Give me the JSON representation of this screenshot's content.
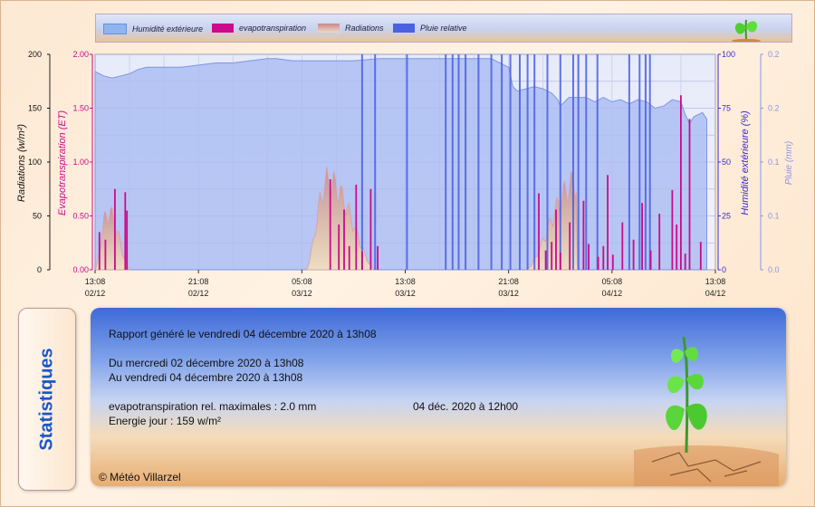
{
  "legend": {
    "items": [
      {
        "label": "Humidité extérieure",
        "color": "#8fb4f0"
      },
      {
        "label": "evapotranspiration",
        "color": "#cc0a8a"
      },
      {
        "label": "Radiations",
        "color": "#d9a0a0"
      },
      {
        "label": "Pluie relative",
        "color": "#4a62e0"
      }
    ]
  },
  "chart_data": {
    "type": "bar",
    "axes": {
      "radiation": {
        "label": "Radiations (w/m²)",
        "range": [
          0,
          200
        ],
        "ticks": [
          "0",
          "50",
          "100",
          "150",
          "200"
        ],
        "color": "#111111"
      },
      "et": {
        "label": "Evapotranspiration (ET)",
        "range": [
          0,
          2.0
        ],
        "ticks": [
          "0.00",
          "0.50",
          "1.00",
          "1.50",
          "2.00"
        ],
        "color": "#cc0a8a"
      },
      "humidity": {
        "label": "Humidité extérieure (%)",
        "range": [
          0,
          100
        ],
        "ticks": [
          "0",
          "25",
          "50",
          "75",
          "100"
        ],
        "color": "#3a2ccc"
      },
      "rain": {
        "label": "Pluie (mm)",
        "range": [
          0,
          0.2
        ],
        "ticks": [
          "0.0",
          "0.1",
          "0.1",
          "0.2",
          "0.2"
        ],
        "color": "#8a94e8"
      }
    },
    "x_ticks": [
      {
        "time": "13:08",
        "date": "02/12"
      },
      {
        "time": "21:08",
        "date": "02/12"
      },
      {
        "time": "05:08",
        "date": "03/12"
      },
      {
        "time": "13:08",
        "date": "03/12"
      },
      {
        "time": "21:08",
        "date": "03/12"
      },
      {
        "time": "05:08",
        "date": "04/12"
      },
      {
        "time": "13:08",
        "date": "04/12"
      }
    ],
    "humidity": [
      [
        0,
        92
      ],
      [
        1,
        90
      ],
      [
        2,
        89
      ],
      [
        3,
        90
      ],
      [
        4,
        91
      ],
      [
        5,
        93
      ],
      [
        6,
        94
      ],
      [
        8,
        94
      ],
      [
        10,
        94
      ],
      [
        12,
        95
      ],
      [
        14,
        96
      ],
      [
        16,
        96
      ],
      [
        18,
        97
      ],
      [
        20,
        98
      ],
      [
        21,
        98
      ],
      [
        23,
        97
      ],
      [
        26,
        97
      ],
      [
        28,
        97
      ],
      [
        30,
        97
      ],
      [
        33,
        98
      ],
      [
        36,
        98
      ],
      [
        39,
        98
      ],
      [
        42,
        98
      ],
      [
        44,
        98
      ],
      [
        46,
        98
      ],
      [
        48,
        94
      ],
      [
        48.5,
        85
      ],
      [
        49,
        83
      ],
      [
        50,
        84
      ],
      [
        51,
        85
      ],
      [
        52,
        84
      ],
      [
        53,
        82
      ],
      [
        53.7,
        79
      ],
      [
        54,
        76
      ],
      [
        55,
        80
      ],
      [
        56,
        80
      ],
      [
        57,
        80
      ],
      [
        58,
        78
      ],
      [
        59,
        80
      ],
      [
        60,
        78
      ],
      [
        61,
        79
      ],
      [
        62,
        77
      ],
      [
        63,
        79
      ],
      [
        64,
        78
      ],
      [
        65,
        75
      ],
      [
        66,
        76
      ],
      [
        67,
        79
      ],
      [
        68,
        78
      ],
      [
        68.5,
        72
      ],
      [
        69,
        68
      ],
      [
        69.5,
        71
      ],
      [
        70,
        72
      ],
      [
        70.5,
        73
      ],
      [
        71,
        70
      ]
    ],
    "radiation_profiles": [
      {
        "start": 0,
        "end": 4,
        "peak_hour": 1.5,
        "peak": 62
      },
      {
        "start": 24.5,
        "end": 32.5,
        "peak_hour": 27,
        "peak": 96
      },
      {
        "start": 50,
        "end": 56,
        "peak_hour": 56,
        "peak": 95
      }
    ],
    "et": [
      [
        0.5,
        0.35
      ],
      [
        1.2,
        0.28
      ],
      [
        2.3,
        0.75
      ],
      [
        3.5,
        0.72
      ],
      [
        3.7,
        0.55
      ],
      [
        27.3,
        0.84
      ],
      [
        28.3,
        0.42
      ],
      [
        28.9,
        0.56
      ],
      [
        29.5,
        0.22
      ],
      [
        30.3,
        0.79
      ],
      [
        31.0,
        0.17
      ],
      [
        32.0,
        0.75
      ],
      [
        32.8,
        0.22
      ],
      [
        51.5,
        0.71
      ],
      [
        52.3,
        0.18
      ],
      [
        53.0,
        0.26
      ],
      [
        53.5,
        0.56
      ],
      [
        54.0,
        0.16
      ],
      [
        55.1,
        0.44
      ],
      [
        56.7,
        0.64
      ],
      [
        57.3,
        0.24
      ],
      [
        58.4,
        0.12
      ],
      [
        59.0,
        0.22
      ],
      [
        59.5,
        0.88
      ],
      [
        60.1,
        0.14
      ],
      [
        61.2,
        0.44
      ],
      [
        62.5,
        0.28
      ],
      [
        63.5,
        0.62
      ],
      [
        64.5,
        0.18
      ],
      [
        65.5,
        0.52
      ],
      [
        67.0,
        0.74
      ],
      [
        67.5,
        0.42
      ],
      [
        68.0,
        1.62
      ],
      [
        68.5,
        0.15
      ],
      [
        69.0,
        1.4
      ],
      [
        70.3,
        0.26
      ]
    ],
    "rain": [
      [
        31.0,
        0.2
      ],
      [
        32.5,
        0.2
      ],
      [
        36.2,
        0.2
      ],
      [
        40.7,
        0.2
      ],
      [
        41.5,
        0.2
      ],
      [
        42.2,
        0.2
      ],
      [
        43.0,
        0.2
      ],
      [
        44.5,
        0.2
      ],
      [
        46.0,
        0.2
      ],
      [
        47.2,
        0.2
      ],
      [
        48.2,
        0.2
      ],
      [
        49.3,
        0.2
      ],
      [
        50.2,
        0.2
      ],
      [
        51.0,
        0.2
      ],
      [
        52.5,
        0.2
      ],
      [
        54.0,
        0.2
      ],
      [
        55.5,
        0.2
      ],
      [
        56.1,
        0.2
      ],
      [
        57.0,
        0.2
      ],
      [
        58.3,
        0.2
      ],
      [
        62.0,
        0.2
      ],
      [
        63.2,
        0.2
      ],
      [
        63.9,
        0.2
      ],
      [
        64.4,
        0.2
      ]
    ]
  },
  "stats": {
    "tab_label": "Statistiques",
    "generated": "Rapport généré le vendredi 04 décembre 2020 à 13h08",
    "from": "Du mercredi 02 décembre 2020 à 13h08",
    "to": "Au vendredi 04 décembre 2020 à 13h08",
    "et_max_label": "evapotranspiration rel. maximales : 2.0 mm",
    "et_max_date": "04 déc. 2020 à 12h00",
    "energy": "Energie jour : 159 w/m²",
    "copyright": "© Météo Villarzel"
  }
}
